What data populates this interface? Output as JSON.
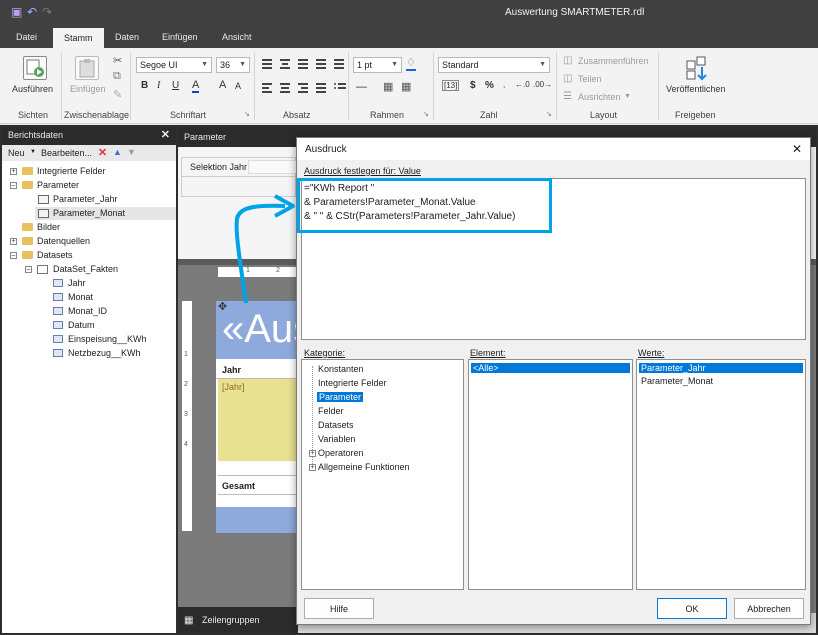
{
  "window": {
    "title": "Auswertung SMARTMETER.rdl"
  },
  "quick_access": {
    "save_icon": "save-icon",
    "undo_icon": "undo-icon",
    "redo_icon": "redo-icon"
  },
  "tabs": [
    {
      "label": "Datei"
    },
    {
      "label": "Stamm",
      "active": true
    },
    {
      "label": "Daten"
    },
    {
      "label": "Einfügen"
    },
    {
      "label": "Ansicht"
    }
  ],
  "ribbon": {
    "groups": [
      "Sichten",
      "Zwischenablage",
      "Schriftart",
      "Absatz",
      "Rahmen",
      "Zahl",
      "Layout",
      "Freigeben"
    ],
    "run_label": "Ausführen",
    "paste_label": "Einfügen",
    "font_name": "Segoe UI",
    "font_size": "36",
    "border_width": "1 pt",
    "number_format": "Standard",
    "merge_label": "Zusammenführen",
    "split_label": "Teilen",
    "align_label": "Ausrichten",
    "publish_label": "Veröffentlichen",
    "bold": "B",
    "italic": "I",
    "underline": "U",
    "font_color": "A",
    "grow_font": "A",
    "shrink_font": "A",
    "currency": "$",
    "percent": "%"
  },
  "report_data": {
    "title": "Berichtsdaten",
    "new_label": "Neu",
    "edit_label": "Bearbeiten...",
    "tree": [
      {
        "label": "Integrierte Felder"
      },
      {
        "label": "Parameter"
      },
      {
        "label": "Parameter_Jahr"
      },
      {
        "label": "Parameter_Monat"
      },
      {
        "label": "Bilder"
      },
      {
        "label": "Datenquellen"
      },
      {
        "label": "Datasets"
      },
      {
        "label": "DataSet_Fakten"
      },
      {
        "label": "Jahr"
      },
      {
        "label": "Monat"
      },
      {
        "label": "Monat_ID"
      },
      {
        "label": "Datum"
      },
      {
        "label": "Einspeisung__KWh"
      },
      {
        "label": "Netzbezug__KWh"
      }
    ]
  },
  "designer": {
    "parameter_header": "Parameter",
    "selection_label": "Selektion Jahr",
    "ruler_numbers": [
      "1",
      "2"
    ],
    "vruler": [
      "1",
      "2",
      "3",
      "4"
    ],
    "report_title_partial": "«Aus",
    "column_header": "Jahr",
    "cell_value": "[Jahr]",
    "total_label": "Gesamt",
    "row_groups_label": "Zeilengruppen"
  },
  "dialog": {
    "title": "Ausdruck",
    "expression_label": "Ausdruck festlegen für: Value",
    "expression_lines": [
      "=\"KWh Report \"",
      "& Parameters!Parameter_Monat.Value",
      "& \" \" & CStr(Parameters!Parameter_Jahr.Value)"
    ],
    "category_label": "Kategorie:",
    "element_label": "Element:",
    "values_label": "Werte:",
    "categories": [
      "Konstanten",
      "Integrierte Felder",
      "Parameter",
      "Felder",
      "Datasets",
      "Variablen",
      "Operatoren",
      "Allgemeine Funktionen"
    ],
    "elements": [
      "<Alle>"
    ],
    "values": [
      "Parameter_Jahr",
      "Parameter_Monat"
    ],
    "help_button": "Hilfe",
    "ok_button": "OK",
    "cancel_button": "Abbrechen"
  },
  "colors": {
    "accent": "#0078d7",
    "highlight": "#00a2e8"
  }
}
